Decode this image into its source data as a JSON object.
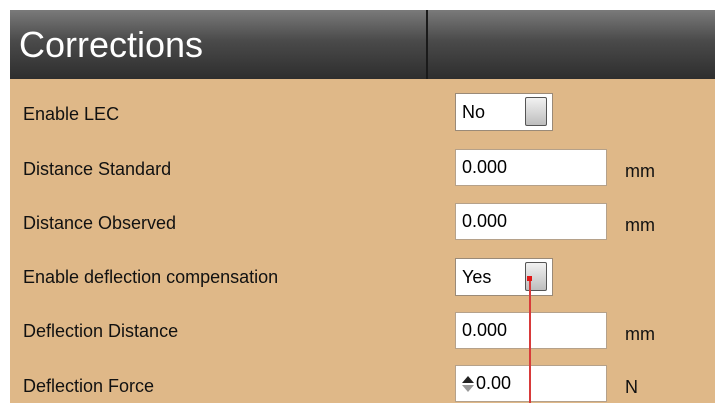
{
  "header": {
    "title": "Corrections"
  },
  "rows": {
    "enable_lec": {
      "label": "Enable LEC",
      "value": "No"
    },
    "distance_standard": {
      "label": "Distance Standard",
      "value": "0.000",
      "unit": "mm"
    },
    "distance_observed": {
      "label": "Distance Observed",
      "value": "0.000",
      "unit": "mm"
    },
    "enable_deflection": {
      "label": "Enable deflection compensation",
      "value": "Yes"
    },
    "deflection_distance": {
      "label": "Deflection Distance",
      "value": "0.000",
      "unit": "mm"
    },
    "deflection_force": {
      "label": "Deflection Force",
      "value": "0.00",
      "unit": "N"
    }
  },
  "colors": {
    "panel_bg": "#dfb888",
    "header_bg": "#3a3a3a",
    "pointer": "#e01818"
  },
  "icons": {
    "toggle_knob": "toggle-knob-icon",
    "spinner": "spin-updown-icon"
  }
}
